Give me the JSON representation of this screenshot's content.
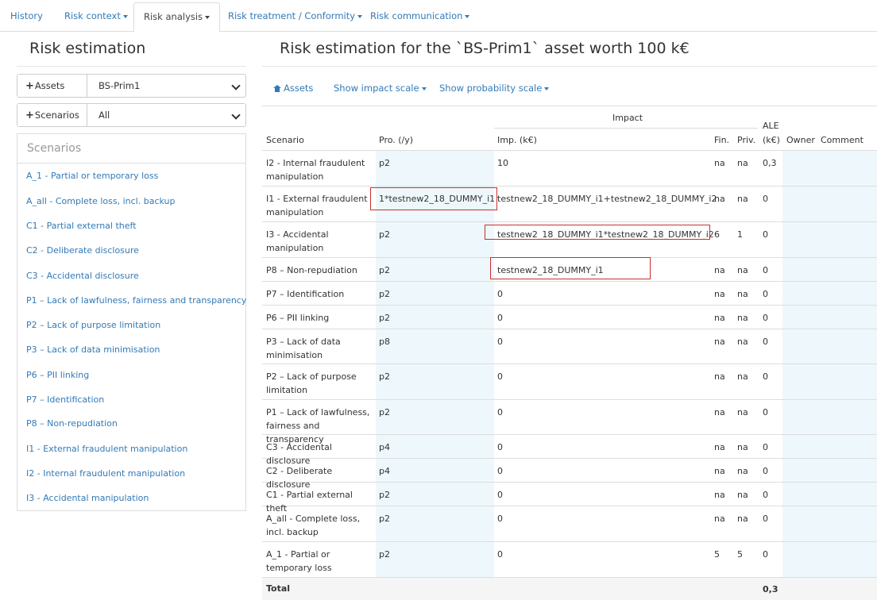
{
  "tabs": [
    {
      "label": "History",
      "dropdown": false
    },
    {
      "label": "Risk context",
      "dropdown": true
    },
    {
      "label": "Risk analysis",
      "dropdown": true,
      "active": true
    },
    {
      "label": "Risk treatment / Conformity",
      "dropdown": true
    },
    {
      "label": "Risk communication",
      "dropdown": true
    }
  ],
  "left": {
    "title": "Risk estimation",
    "assets_button": "Assets",
    "assets_value": "BS-Prim1",
    "scenarios_button": "Scenarios",
    "scenarios_value": "All",
    "scenarios_header": "Scenarios",
    "scenario_list": [
      "A_1 - Partial or temporary loss",
      "A_all - Complete loss, incl. backup",
      "C1 - Partial external theft",
      "C2 - Deliberate disclosure",
      "C3 - Accidental disclosure",
      "P1 – Lack of lawfulness, fairness and transparency",
      "P2 – Lack of purpose limitation",
      "P3 – Lack of data minimisation",
      "P6 – PII linking",
      "P7 – Identification",
      "P8 – Non-repudiation",
      "I1 - External fraudulent manipulation",
      "I2 - Internal fraudulent manipulation",
      "I3 - Accidental manipulation"
    ]
  },
  "right": {
    "title": "Risk estimation for the `BS-Prim1` asset worth 100 k€",
    "toolbar": {
      "assets": "Assets",
      "impact_scale": "Show impact scale",
      "probability_scale": "Show probability scale"
    },
    "headers": {
      "impact_group": "Impact",
      "scenario": "Scenario",
      "pro": "Pro. (/y)",
      "imp": "Imp. (k€)",
      "fin": "Fin.",
      "priv": "Priv.",
      "ale_top": "ALE",
      "ale_bottom": "(k€)",
      "owner": "Owner",
      "comment": "Comment"
    },
    "rows": [
      {
        "scenario": "I2 - Internal fraudulent manipulation",
        "pro": "p2",
        "imp": "10",
        "fin": "na",
        "priv": "na",
        "ale": "0,3"
      },
      {
        "scenario": "I1 - External fraudulent manipulation",
        "pro": "1*testnew2_18_DUMMY_i1",
        "imp": "testnew2_18_DUMMY_i1+testnew2_18_DUMMY_i2",
        "fin": "na",
        "priv": "na",
        "ale": "0"
      },
      {
        "scenario": "I3 - Accidental manipulation",
        "pro": "p2",
        "imp": "testnew2_18_DUMMY_i1*testnew2_18_DUMMY_i2",
        "fin": "6",
        "priv": "1",
        "ale": "0"
      },
      {
        "scenario": "P8 – Non-repudiation",
        "pro": "p2",
        "imp": "testnew2_18_DUMMY_i1",
        "fin": "na",
        "priv": "na",
        "ale": "0"
      },
      {
        "scenario": "P7 – Identification",
        "pro": "p2",
        "imp": "0",
        "fin": "na",
        "priv": "na",
        "ale": "0"
      },
      {
        "scenario": "P6 – PII linking",
        "pro": "p2",
        "imp": "0",
        "fin": "na",
        "priv": "na",
        "ale": "0"
      },
      {
        "scenario": "P3 – Lack of data minimisation",
        "pro": "p8",
        "imp": "0",
        "fin": "na",
        "priv": "na",
        "ale": "0"
      },
      {
        "scenario": "P2 – Lack of purpose limitation",
        "pro": "p2",
        "imp": "0",
        "fin": "na",
        "priv": "na",
        "ale": "0"
      },
      {
        "scenario": "P1 – Lack of lawfulness, fairness and transparency",
        "pro": "p2",
        "imp": "0",
        "fin": "na",
        "priv": "na",
        "ale": "0"
      },
      {
        "scenario": "C3 - Accidental disclosure",
        "pro": "p4",
        "imp": "0",
        "fin": "na",
        "priv": "na",
        "ale": "0"
      },
      {
        "scenario": "C2 - Deliberate disclosure",
        "pro": "p4",
        "imp": "0",
        "fin": "na",
        "priv": "na",
        "ale": "0"
      },
      {
        "scenario": "C1 - Partial external theft",
        "pro": "p2",
        "imp": "0",
        "fin": "na",
        "priv": "na",
        "ale": "0"
      },
      {
        "scenario": "A_all - Complete loss, incl. backup",
        "pro": "p2",
        "imp": "0",
        "fin": "na",
        "priv": "na",
        "ale": "0"
      },
      {
        "scenario": "A_1 - Partial or temporary loss",
        "pro": "p2",
        "imp": "0",
        "fin": "5",
        "priv": "5",
        "ale": "0"
      }
    ],
    "total_label": "Total",
    "total_value": "0,3"
  },
  "colors": {
    "link": "#337ab7",
    "editable_shade": "#eef7fb",
    "error_border": "#c9302c"
  }
}
